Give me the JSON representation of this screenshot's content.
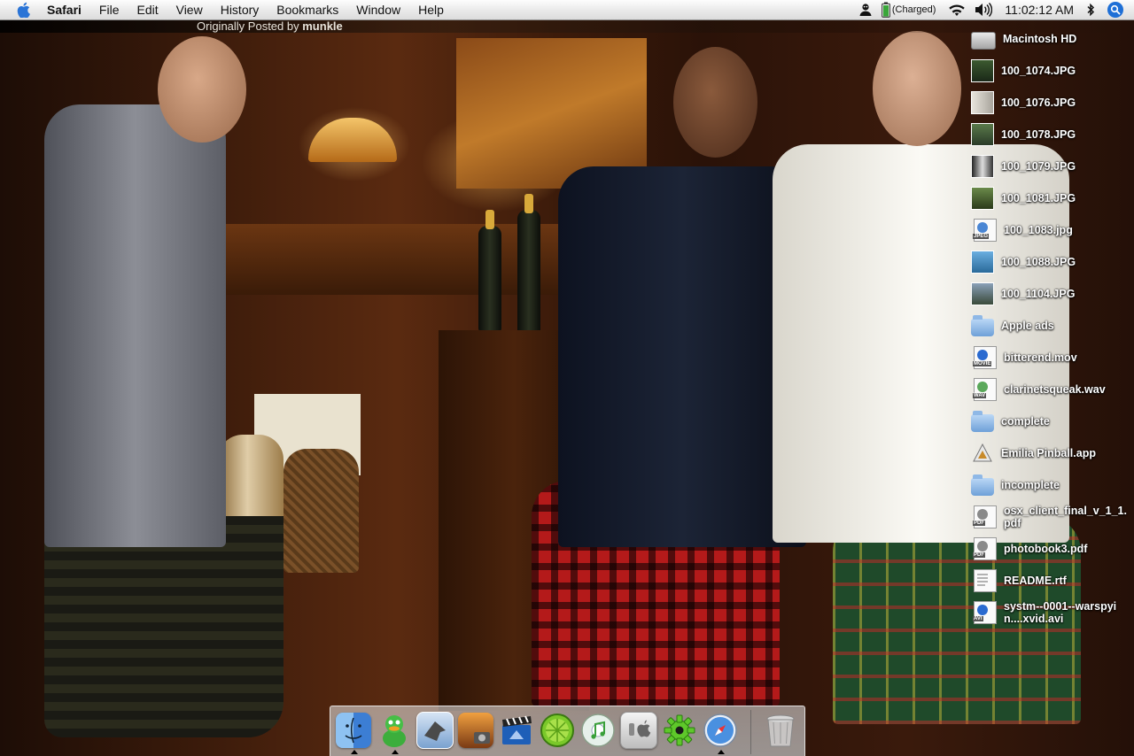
{
  "menubar": {
    "app_name": "Safari",
    "menus": [
      "File",
      "Edit",
      "View",
      "History",
      "Bookmarks",
      "Window",
      "Help"
    ],
    "battery_status": "(Charged)",
    "clock": "11:02:12 AM",
    "icons": [
      "apple-icon",
      "user-account-icon",
      "battery-icon",
      "wifi-icon",
      "volume-icon",
      "bluetooth-icon",
      "spotlight-icon"
    ]
  },
  "wallpaper": {
    "caption_prefix": "Originally Posted by",
    "caption_author": "munkle"
  },
  "desktop_items": [
    {
      "label": "Macintosh HD",
      "kind": "harddisk"
    },
    {
      "label": "100_1074.JPG",
      "kind": "photo"
    },
    {
      "label": "100_1076.JPG",
      "kind": "photo"
    },
    {
      "label": "100_1078.JPG",
      "kind": "photo"
    },
    {
      "label": "100_1079.JPG",
      "kind": "photo"
    },
    {
      "label": "100_1081.JPG",
      "kind": "photo"
    },
    {
      "label": "100_1083.jpg",
      "kind": "jpeg-doc"
    },
    {
      "label": "100_1088.JPG",
      "kind": "photo"
    },
    {
      "label": "100_1104.JPG",
      "kind": "photo"
    },
    {
      "label": "Apple ads",
      "kind": "folder"
    },
    {
      "label": "bitterend.mov",
      "kind": "movie"
    },
    {
      "label": "clarinetsqueak.wav",
      "kind": "audio"
    },
    {
      "label": "complete",
      "kind": "folder"
    },
    {
      "label": "Emilia Pinball.app",
      "kind": "app"
    },
    {
      "label": "incomplete",
      "kind": "folder"
    },
    {
      "label": "osx_client_final_v_1_1.pdf",
      "kind": "pdf"
    },
    {
      "label": "photobook3.pdf",
      "kind": "pdf"
    },
    {
      "label": "README.rtf",
      "kind": "text"
    },
    {
      "label": "systm--0001--warspyin....xvid.avi",
      "kind": "avi"
    }
  ],
  "dock": {
    "items": [
      "finder-icon",
      "adium-icon",
      "mail-icon",
      "iphoto-icon",
      "imovie-icon",
      "limewire-icon",
      "itunes-icon",
      "system-preferences-icon",
      "gear-app-icon",
      "safari-icon"
    ],
    "trash": "trash-icon"
  }
}
